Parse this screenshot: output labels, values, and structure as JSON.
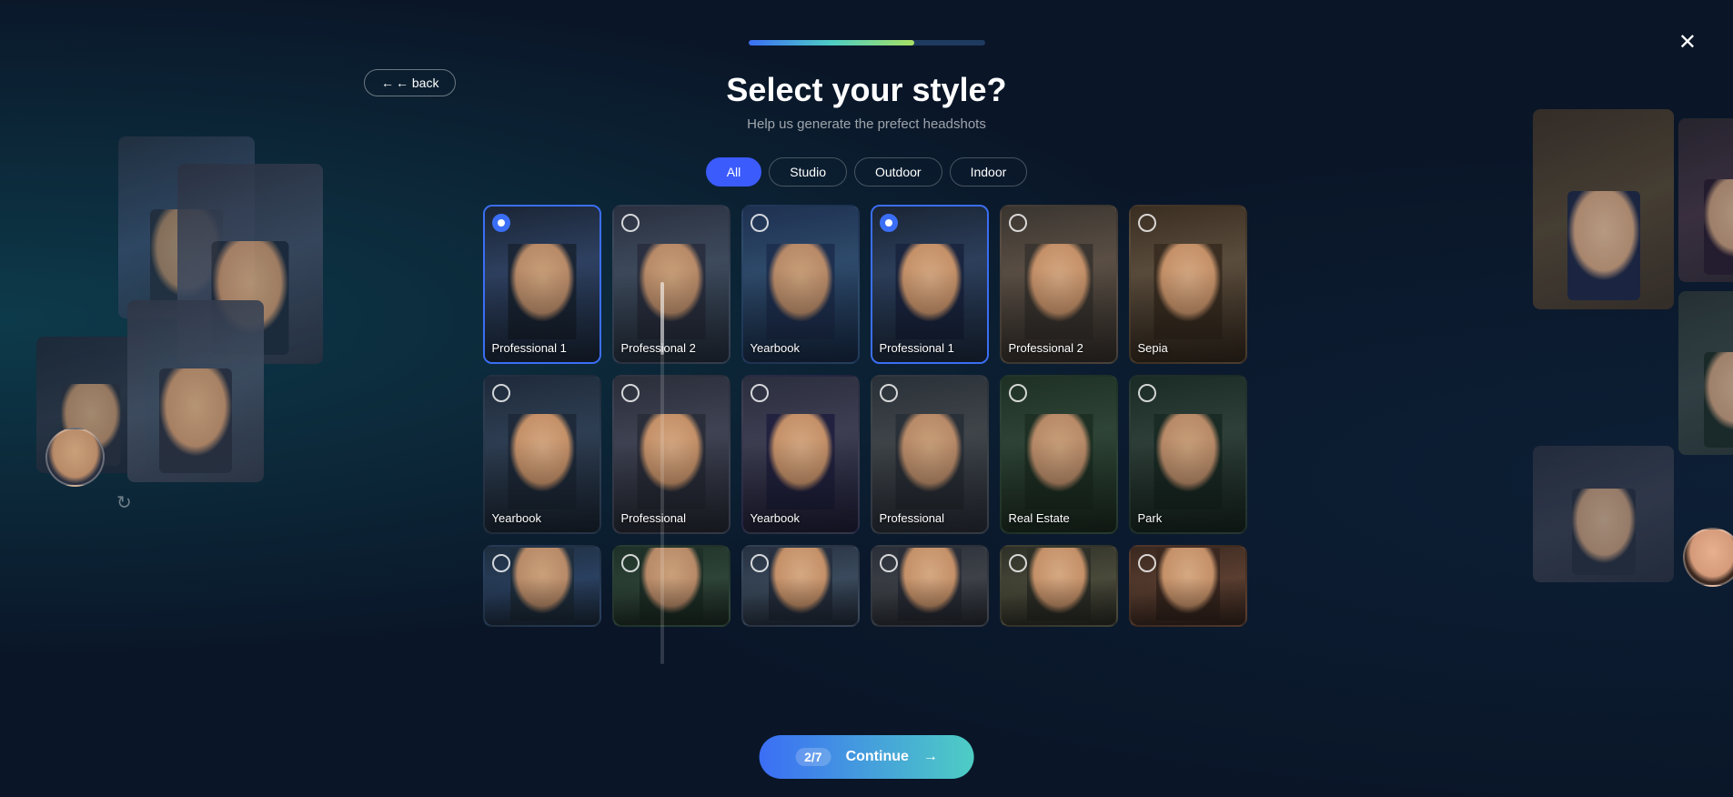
{
  "app": {
    "title": "Select your style?",
    "subtitle": "Help us generate the prefect headshots",
    "close_label": "✕",
    "back_label": "← back"
  },
  "progress": {
    "current": 2,
    "total": 7,
    "percent": 70
  },
  "filters": [
    {
      "id": "all",
      "label": "All",
      "active": true
    },
    {
      "id": "studio",
      "label": "Studio",
      "active": false
    },
    {
      "id": "outdoor",
      "label": "Outdoor",
      "active": false
    },
    {
      "id": "indoor",
      "label": "Indoor",
      "active": false
    }
  ],
  "style_cards": [
    {
      "id": "pro1",
      "label": "Professional 1",
      "selected": true,
      "row": 1,
      "bg": "card-professional1",
      "gender": "male"
    },
    {
      "id": "pro2",
      "label": "Professional 2",
      "selected": false,
      "row": 1,
      "bg": "card-professional2-1",
      "gender": "male"
    },
    {
      "id": "yb1",
      "label": "Yearbook",
      "selected": false,
      "row": 1,
      "bg": "card-yearbook1",
      "gender": "male"
    },
    {
      "id": "pro1f",
      "label": "Professional 1",
      "selected": true,
      "row": 1,
      "bg": "card-professional1-f",
      "gender": "female"
    },
    {
      "id": "pro2f",
      "label": "Professional 2",
      "selected": false,
      "row": 1,
      "bg": "card-professional2-f",
      "gender": "female"
    },
    {
      "id": "sepia",
      "label": "Sepia",
      "selected": false,
      "row": 1,
      "bg": "card-sepia",
      "gender": "female"
    },
    {
      "id": "yb2",
      "label": "Yearbook",
      "selected": false,
      "row": 2,
      "bg": "card-yearbook2",
      "gender": "female"
    },
    {
      "id": "pro3",
      "label": "Professional",
      "selected": false,
      "row": 2,
      "bg": "card-professional3",
      "gender": "female"
    },
    {
      "id": "yb3",
      "label": "Yearbook",
      "selected": false,
      "row": 2,
      "bg": "card-yearbook3",
      "gender": "female"
    },
    {
      "id": "pro4",
      "label": "Professional",
      "selected": false,
      "row": 2,
      "bg": "card-professional4",
      "gender": "male"
    },
    {
      "id": "re",
      "label": "Real Estate",
      "selected": false,
      "row": 2,
      "bg": "card-realestate",
      "gender": "male"
    },
    {
      "id": "park",
      "label": "Park",
      "selected": false,
      "row": 2,
      "bg": "card-park",
      "gender": "male"
    }
  ],
  "continue_button": {
    "label": "Continue",
    "arrow": "→",
    "badge": "2/7"
  },
  "card_colors": {
    "card-professional1": "#1e3050",
    "card-professional2-1": "#2a3545",
    "card-yearbook1": "#1e3a5a",
    "card-professional1-f": "#1e2e45",
    "card-professional2-f": "#3a3530",
    "card-sepia": "#3a2e22",
    "card-yearbook2": "#1e2a3a",
    "card-professional3": "#2a2e3a",
    "card-yearbook3": "#222240",
    "card-professional4": "#2e3440",
    "card-realestate": "#1e3024",
    "card-park": "#1a2a24"
  }
}
